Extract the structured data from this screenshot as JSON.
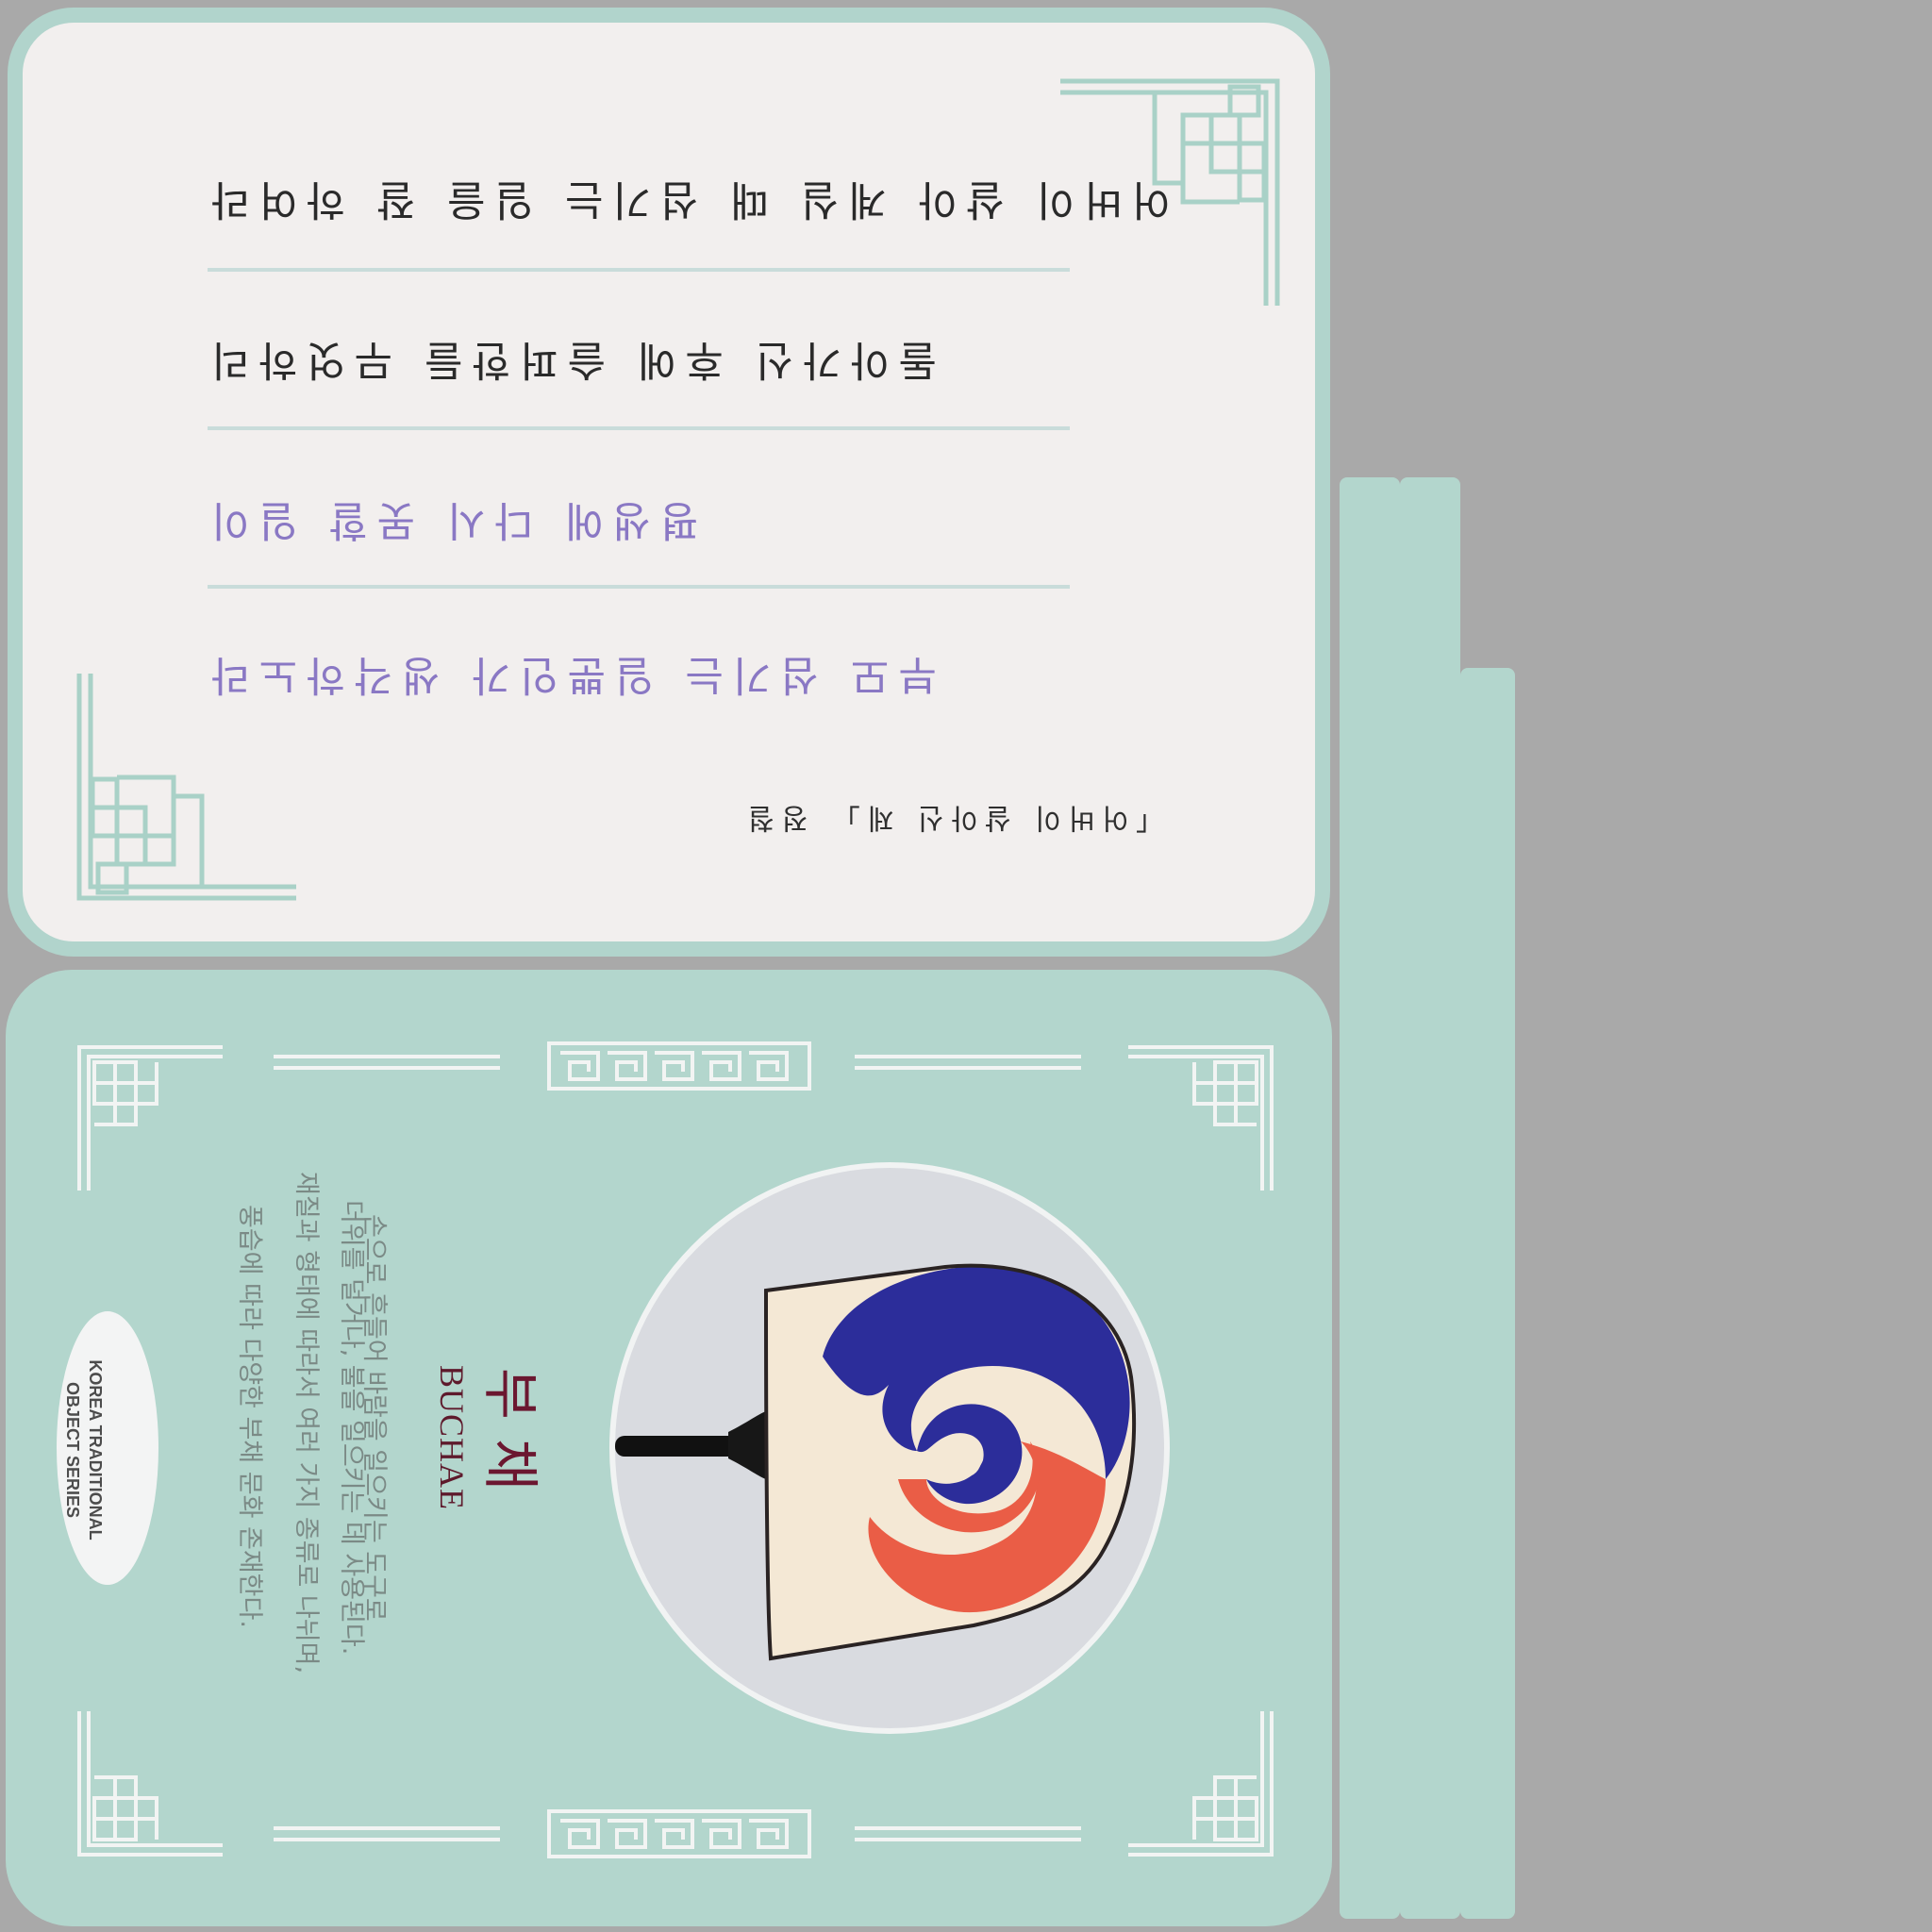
{
  "poem": {
    "lines": [
      "어버이 살아 계실 때 섬기는 일을 잘 하여라",
      "돌아가신 후에 슬퍼한들 무엇하리",
      "평생에 다시 못할 일이",
      "부모 섬기는 일뿐인가 생각하노라"
    ],
    "attribution": "「어버이 살아신 제」 정철"
  },
  "info": {
    "title_ko": "부채",
    "title_en": "BUCHAE",
    "description": [
      "손으로 흔들어 바람을 일으키는 도구로",
      "더위를 덜거나, 불을 일으키는 데 사용된다.",
      "재질과 형태에 따라서 여러 가지 종류로 나뉘며,",
      "풍습에 따라 다양한 부채 문화 존재한다."
    ],
    "series": [
      "KOREA TRADITIONAL",
      "OBJECT SERIES"
    ]
  },
  "colors": {
    "mint": "#b3d6cd",
    "paper": "#f2efee",
    "title": "#6b1730",
    "accent_purple": "#8a78c4",
    "fan_blue": "#2c2d9a",
    "fan_red": "#ea5d46",
    "fan_cream": "#f4e8d5"
  }
}
